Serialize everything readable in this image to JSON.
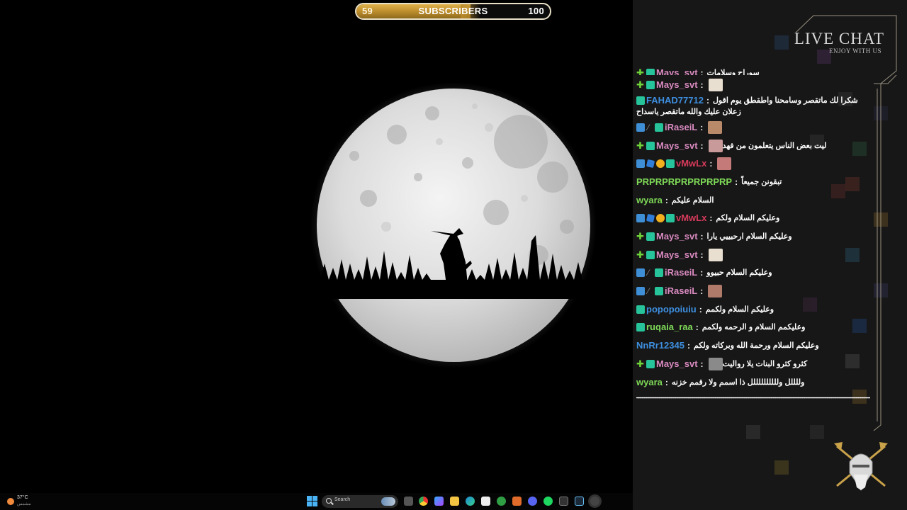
{
  "subscriber_goal": {
    "current": "59",
    "label": "SUBSCRIBERS",
    "goal": "100",
    "progress_fraction": 0.59
  },
  "taskbar": {
    "weather_temp": "37°C",
    "weather_condition": "مشمس",
    "search_placeholder": "Search",
    "icons": [
      "start-icon",
      "search-icon",
      "task-view-icon",
      "chrome-icon",
      "copilot-icon",
      "file-explorer-icon",
      "edge-icon",
      "store-icon",
      "xbox-icon",
      "app-a-icon",
      "discord-icon",
      "spotify-icon",
      "terminal-icon",
      "steam-icon",
      "app-active-icon"
    ]
  },
  "chat": {
    "title": "LIVE CHAT",
    "subtitle": "ENJOY WITH US",
    "messages": [
      {
        "user": "Mays_svt",
        "color": "#d98ac0",
        "text": "سوراح وسلامات",
        "badges": [
          "plus",
          "green"
        ],
        "emote": null,
        "cut": true
      },
      {
        "user": "Mays_svt",
        "color": "#d98ac0",
        "text": "",
        "badges": [
          "plus",
          "green"
        ],
        "emote": "#e9dfd0"
      },
      {
        "user": "FAHAD77712",
        "color": "#3d8fe0",
        "text": "شكرا لك ماتقصر وسامحنا واطقطق يوم اقول",
        "text2": "زعلان عليك والله ماتقصر ياسداح",
        "badges": [
          "green"
        ],
        "emote": null
      },
      {
        "user": "iRaseiL",
        "color": "#d98ac0",
        "text": "",
        "badges": [
          "blue",
          "pen",
          "green"
        ],
        "emote": "#b98a6a"
      },
      {
        "user": "Mays_svt",
        "color": "#d98ac0",
        "text": "ليت بعض الناس يتعلمون من فهد",
        "badges": [
          "plus",
          "green"
        ],
        "emote": "#c99a9a"
      },
      {
        "user": "vMwLx",
        "color": "#d63a5a",
        "text": "",
        "badges": [
          "blue",
          "cube",
          "coin",
          "green"
        ],
        "emote": "#c57a7a"
      },
      {
        "user": "PRPRPRPRPRPRPRP",
        "color": "#7ed957",
        "text": "تبقونن جميعاً",
        "badges": [],
        "emote": null
      },
      {
        "user": "wyara",
        "color": "#7ed957",
        "text": "السلام عليكم",
        "badges": [],
        "emote": null
      },
      {
        "user": "vMwLx",
        "color": "#d63a5a",
        "text": "وعليكم السلام ولكم",
        "badges": [
          "blue",
          "cube",
          "coin",
          "green"
        ],
        "emote": null
      },
      {
        "user": "Mays_svt",
        "color": "#d98ac0",
        "text": "وعليكم السلام ارحبييي يارا",
        "badges": [
          "plus",
          "green"
        ],
        "emote": null
      },
      {
        "user": "Mays_svt",
        "color": "#d98ac0",
        "text": "",
        "badges": [
          "plus",
          "green"
        ],
        "emote": "#e9dfd0"
      },
      {
        "user": "iRaseiL",
        "color": "#d98ac0",
        "text": "وعليكم السلام حبيوو",
        "badges": [
          "blue",
          "pen",
          "green"
        ],
        "emote": null
      },
      {
        "user": "iRaseiL",
        "color": "#d98ac0",
        "text": "",
        "badges": [
          "blue",
          "pen",
          "green"
        ],
        "emote": "#b07a6a"
      },
      {
        "user": "popopoiuiu",
        "color": "#3d8fe0",
        "text": "وعليكم السلام ولكمم",
        "badges": [
          "green"
        ],
        "emote": null
      },
      {
        "user": "ruqaia_raa",
        "color": "#7ed957",
        "text": "وعليكمم السلام و الرحمه ولكمم",
        "badges": [
          "green"
        ],
        "emote": null
      },
      {
        "user": "NnRr12345",
        "color": "#3d8fe0",
        "text": "وعليكم السلام ورحمة الله وبركاته ولكم",
        "badges": [],
        "emote": null
      },
      {
        "user": "Mays_svt",
        "color": "#d98ac0",
        "text": "كثرو كثرو البنات يلا رواليت",
        "badges": [
          "plus",
          "green"
        ],
        "emote": "#8a8a8a"
      },
      {
        "user": "wyara",
        "color": "#7ed957",
        "text": "وللللل وللللللللللل ذا اسمم ولا رقمم خزنه",
        "badges": [],
        "emote": null
      }
    ],
    "trailing_line": "ــــــــــــــــــــــــــــــــــــــــــــــــــــــــــــــــــــــــــــــــــــــــــــــــــــــــــــــــــــــــ"
  },
  "colors": {
    "accent_gold": "#c9a24a",
    "chat_bg": "#171717",
    "frame_line": "#b9b09a"
  }
}
